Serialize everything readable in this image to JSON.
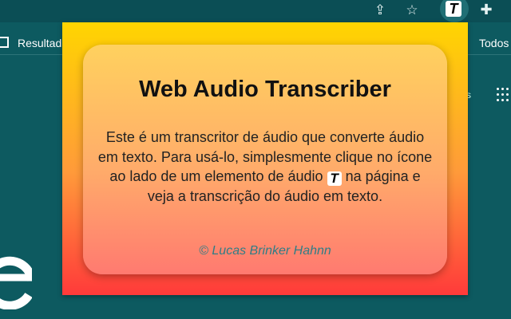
{
  "browser": {
    "toolbar": {
      "share_icon": "share-icon",
      "star_icon": "star-icon",
      "extension_icon": "transcriber-extension-icon",
      "extension_letter": "T",
      "puzzle_icon": "extensions-puzzle-icon"
    },
    "bookmarks": {
      "left_label": "Resultad",
      "right_label": "Todos"
    },
    "page_partial_letter": "e",
    "page_small_text": "s"
  },
  "popup": {
    "title": "Web Audio Transcriber",
    "description_before": "Este é um transcritor de áudio que converte áudio em texto. Para usá-lo, simplesmente clique no ícone ao lado de um elemento de áudio",
    "inline_icon_letter": "T",
    "description_after": "na página e veja a transcrição do áudio em texto.",
    "credit": "© Lucas Brinker Hahnn"
  },
  "colors": {
    "page_bg": "#0d5a60",
    "popup_top": "#ffd500",
    "popup_bottom": "#ff3a3a",
    "credit_text": "#2f7d86"
  }
}
